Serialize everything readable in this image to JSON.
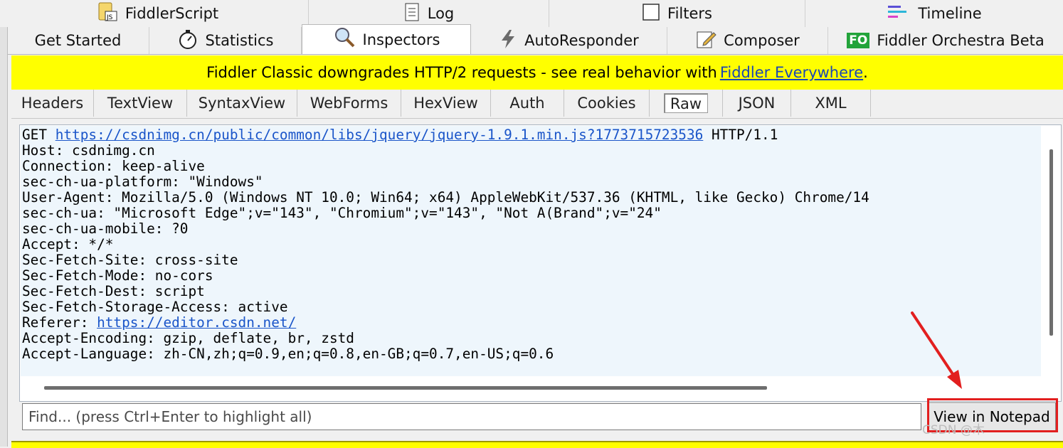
{
  "tabs_row1": [
    {
      "label": "FiddlerScript",
      "icon": "script-js-icon"
    },
    {
      "label": "Log",
      "icon": "log-document-icon"
    },
    {
      "label": "Filters",
      "icon": "checkbox-icon"
    },
    {
      "label": "Timeline",
      "icon": "timeline-bars-icon"
    }
  ],
  "tabs_row2": [
    {
      "label": "Get Started",
      "icon": ""
    },
    {
      "label": "Statistics",
      "icon": "stopwatch-icon"
    },
    {
      "label": "Inspectors",
      "icon": "magnifier-icon",
      "active": true
    },
    {
      "label": "AutoResponder",
      "icon": "lightning-icon"
    },
    {
      "label": "Composer",
      "icon": "pencil-icon"
    },
    {
      "label": "Fiddler Orchestra Beta",
      "icon": "fo-badge-icon",
      "badge": "FO"
    }
  ],
  "banner": {
    "text": "Fiddler Classic downgrades HTTP/2 requests - see real behavior with",
    "link": "Fiddler Everywhere",
    "suffix": "."
  },
  "subtabs": [
    "Headers",
    "TextView",
    "SyntaxView",
    "WebForms",
    "HexView",
    "Auth",
    "Cookies",
    "Raw",
    "JSON",
    "XML"
  ],
  "selected_subtab": "Raw",
  "raw": {
    "method": "GET ",
    "url": "https://csdnimg.cn/public/common/libs/jquery/jquery-1.9.1.min.js?1773715723536",
    "protocol": " HTTP/1.1",
    "lines_before_referer": [
      "Host: csdnimg.cn",
      "Connection: keep-alive",
      "sec-ch-ua-platform: \"Windows\"",
      "User-Agent: Mozilla/5.0 (Windows NT 10.0; Win64; x64) AppleWebKit/537.36 (KHTML, like Gecko) Chrome/14",
      "sec-ch-ua: \"Microsoft Edge\";v=\"143\", \"Chromium\";v=\"143\", \"Not A(Brand\";v=\"24\"",
      "sec-ch-ua-mobile: ?0",
      "Accept: */*",
      "Sec-Fetch-Site: cross-site",
      "Sec-Fetch-Mode: no-cors",
      "Sec-Fetch-Dest: script",
      "Sec-Fetch-Storage-Access: active"
    ],
    "referer_label": "Referer: ",
    "referer_url": "https://editor.csdn.net/",
    "lines_after_referer": [
      "Accept-Encoding: gzip, deflate, br, zstd",
      "Accept-Language: zh-CN,zh;q=0.9,en;q=0.8,en-GB;q=0.7,en-US;q=0.6"
    ]
  },
  "find": {
    "placeholder": "Find... (press Ctrl+Enter to highlight all)"
  },
  "notepad_button": "View in Notepad",
  "watermark": "CSDN @木",
  "annotation_color": "#e21f1f",
  "banner_color": "#ffff00"
}
